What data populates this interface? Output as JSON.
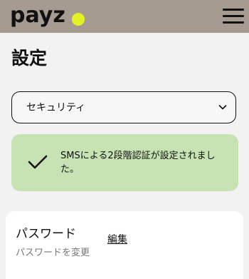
{
  "header": {
    "logo_text": "payz",
    "logo_dot_color": "#e4f225",
    "background_color": "#a59b91",
    "menu_icon": "hamburger-menu-icon"
  },
  "page": {
    "title": "設定"
  },
  "section_select": {
    "selected_value": "セキュリティ",
    "icon": "chevron-down-icon"
  },
  "alert": {
    "icon": "checkmark-icon",
    "message": "SMSによる2段階認証が設定されました。",
    "background_color": "#c7e3b4"
  },
  "password_card": {
    "title": "パスワード",
    "subtitle": "パスワードを変更",
    "edit_label": "編集"
  }
}
